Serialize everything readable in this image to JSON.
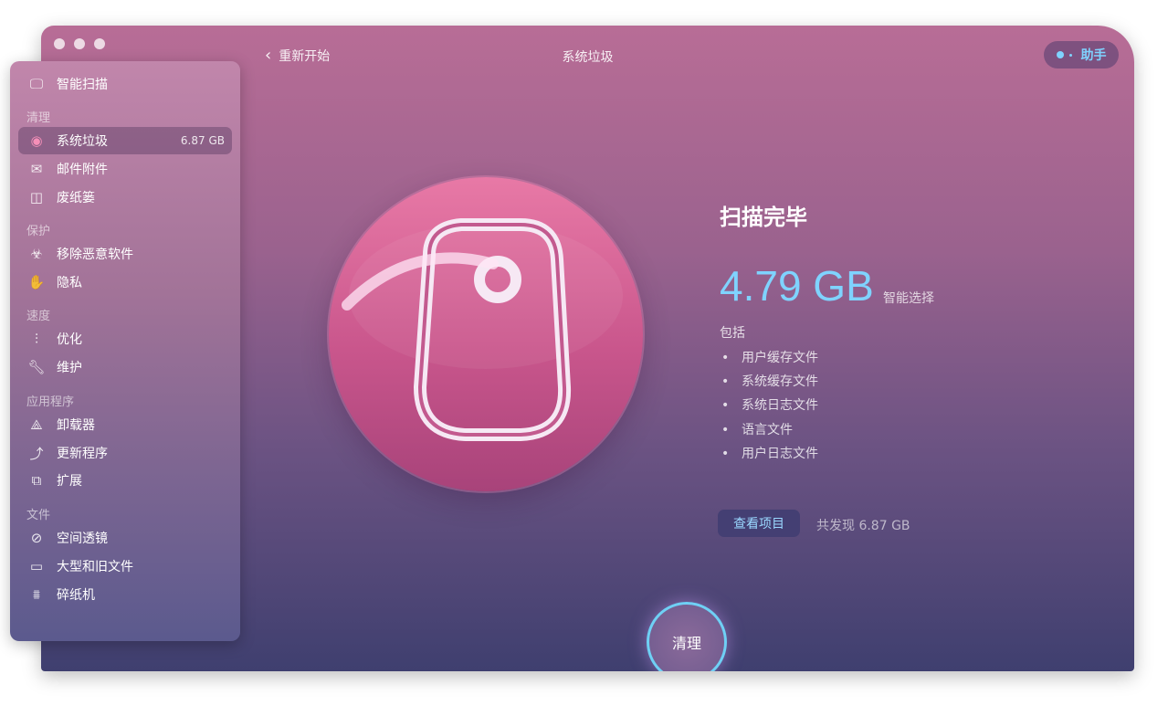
{
  "window": {
    "title": "系统垃圾",
    "back_label": "重新开始",
    "assistant_label": "助手"
  },
  "sidebar": {
    "top_item": {
      "label": "智能扫描",
      "icon": "monitor-icon"
    },
    "sections": [
      {
        "title": "清理",
        "items": [
          {
            "label": "系统垃圾",
            "icon": "junk-icon",
            "size": "6.87 GB",
            "active": true
          },
          {
            "label": "邮件附件",
            "icon": "mail-icon"
          },
          {
            "label": "废纸篓",
            "icon": "trash-icon"
          }
        ]
      },
      {
        "title": "保护",
        "items": [
          {
            "label": "移除恶意软件",
            "icon": "biohazard-icon"
          },
          {
            "label": "隐私",
            "icon": "hand-icon"
          }
        ]
      },
      {
        "title": "速度",
        "items": [
          {
            "label": "优化",
            "icon": "sliders-icon"
          },
          {
            "label": "维护",
            "icon": "wrench-icon"
          }
        ]
      },
      {
        "title": "应用程序",
        "items": [
          {
            "label": "卸载器",
            "icon": "uninstaller-icon"
          },
          {
            "label": "更新程序",
            "icon": "update-icon"
          },
          {
            "label": "扩展",
            "icon": "puzzle-icon"
          }
        ]
      },
      {
        "title": "文件",
        "items": [
          {
            "label": "空间透镜",
            "icon": "planet-icon"
          },
          {
            "label": "大型和旧文件",
            "icon": "folder-icon"
          },
          {
            "label": "碎纸机",
            "icon": "shredder-icon"
          }
        ]
      }
    ]
  },
  "main": {
    "heading": "扫描完毕",
    "size": "4.79 GB",
    "smart_select": "智能选择",
    "includes_label": "包括",
    "includes": [
      "用户缓存文件",
      "系统缓存文件",
      "系统日志文件",
      "语言文件",
      "用户日志文件"
    ],
    "view_items_label": "查看项目",
    "found_text": "共发现 6.87 GB",
    "clean_label": "清理"
  },
  "colors": {
    "accent": "#7fd3ff",
    "circle": "#d8608f"
  }
}
